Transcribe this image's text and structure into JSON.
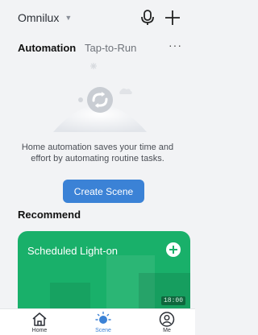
{
  "topbar": {
    "home_name": "Omnilux",
    "icons": [
      "chevron-down-icon",
      "mic-icon",
      "plus-icon"
    ]
  },
  "tabs": {
    "automation": "Automation",
    "tap_to_run": "Tap-to-Run",
    "more": "···"
  },
  "empty_state": {
    "message": "Home automation saves your time and effort by automating routine tasks.",
    "create_button": "Create Scene"
  },
  "recommend": {
    "heading": "Recommend",
    "card": {
      "title": "Scheduled Light-on",
      "time": "18:00"
    }
  },
  "bottom_nav": {
    "items": [
      {
        "label": "Home",
        "icon": "home-icon",
        "active": false
      },
      {
        "label": "Scene",
        "icon": "scene-icon",
        "active": true
      },
      {
        "label": "Me",
        "icon": "profile-icon",
        "active": false
      }
    ]
  },
  "colors": {
    "accent": "#3b82d6",
    "card": "#19b06a",
    "background": "#f2f3f5"
  }
}
